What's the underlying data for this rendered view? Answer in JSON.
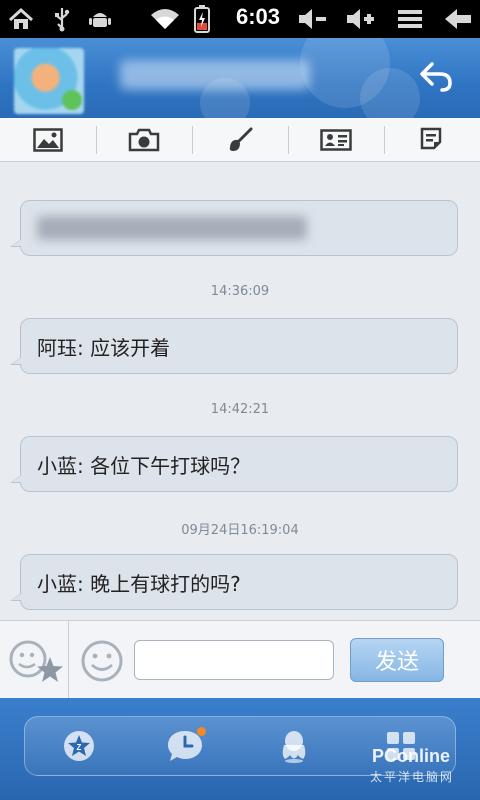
{
  "status_bar": {
    "time": "6:03",
    "icons": [
      "home-icon",
      "usb-icon",
      "android-debug-icon",
      "wifi-icon",
      "battery-charging-icon",
      "volume-down-icon",
      "volume-up-icon",
      "menu-icon",
      "back-arrow-icon"
    ]
  },
  "header": {
    "avatar": "contact-avatar",
    "back_icon": "return-arrow-icon"
  },
  "toolbar": {
    "items": [
      "image-icon",
      "camera-icon",
      "brush-icon",
      "contact-card-icon",
      "notes-icon"
    ]
  },
  "chat": {
    "messages": [
      {
        "text": "",
        "blurred": true
      },
      {
        "timestamp": "14:36:09",
        "text": "阿珏: 应该开着"
      },
      {
        "timestamp": "14:42:21",
        "text": "小蓝: 各位下午打球吗？"
      },
      {
        "timestamp": "09月24日16:19:04",
        "text": "小蓝: 晚上有球打的吗?"
      }
    ]
  },
  "input_bar": {
    "fav_icon": "favorite-emoticon-icon",
    "emoji_icon": "smiley-icon",
    "input_value": "",
    "input_placeholder": "",
    "send_label": "发送"
  },
  "bottom_nav": {
    "items": [
      "qzone-star-icon",
      "recent-clock-icon",
      "qq-penguin-icon",
      "apps-grid-icon"
    ],
    "notification_color": "#f08a24"
  },
  "watermark": {
    "brand": "PConline",
    "sub": "太平洋电脑网"
  },
  "colors": {
    "header_blue": "#2f74c2",
    "bubble_bg": "#dde3ea",
    "send_button": "#86b6e4"
  }
}
